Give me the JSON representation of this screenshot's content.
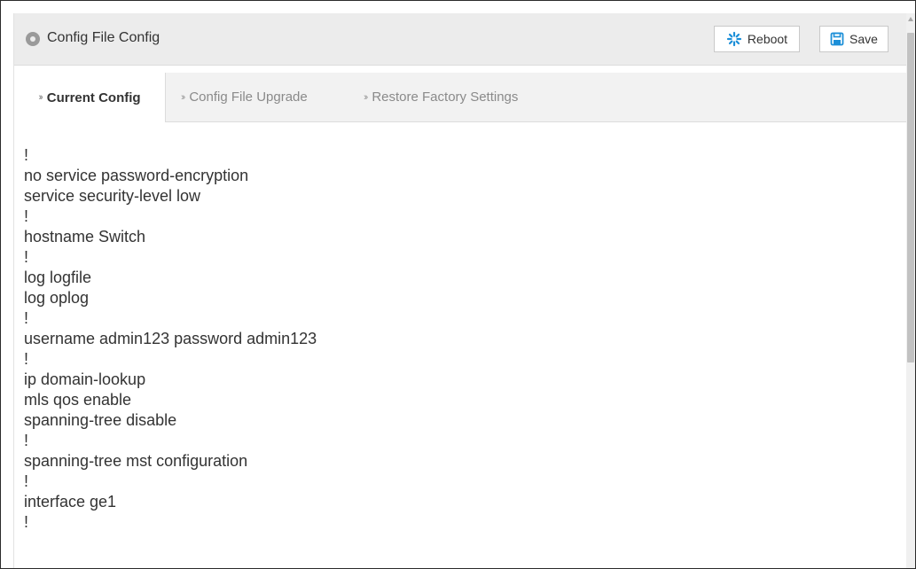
{
  "header": {
    "title": "Config File Config",
    "icon": "location-pin-icon",
    "reboot_label": "Reboot",
    "save_label": "Save"
  },
  "tabs": [
    {
      "label": "Current Config",
      "active": true
    },
    {
      "label": "Config File Upgrade",
      "active": false
    },
    {
      "label": "Restore Factory Settings",
      "active": false
    }
  ],
  "config_lines": [
    "!",
    "no service password-encryption",
    "service security-level low",
    "!",
    "hostname Switch",
    "!",
    "log logfile",
    "log oplog",
    "!",
    "username admin123 password admin123",
    "!",
    "ip domain-lookup",
    "mls qos enable",
    "spanning-tree disable",
    "!",
    "spanning-tree mst configuration",
    "!",
    "interface ge1",
    "!"
  ],
  "colors": {
    "header_bg": "#ececec",
    "accent": "#1c8fd8",
    "text": "#333333"
  }
}
